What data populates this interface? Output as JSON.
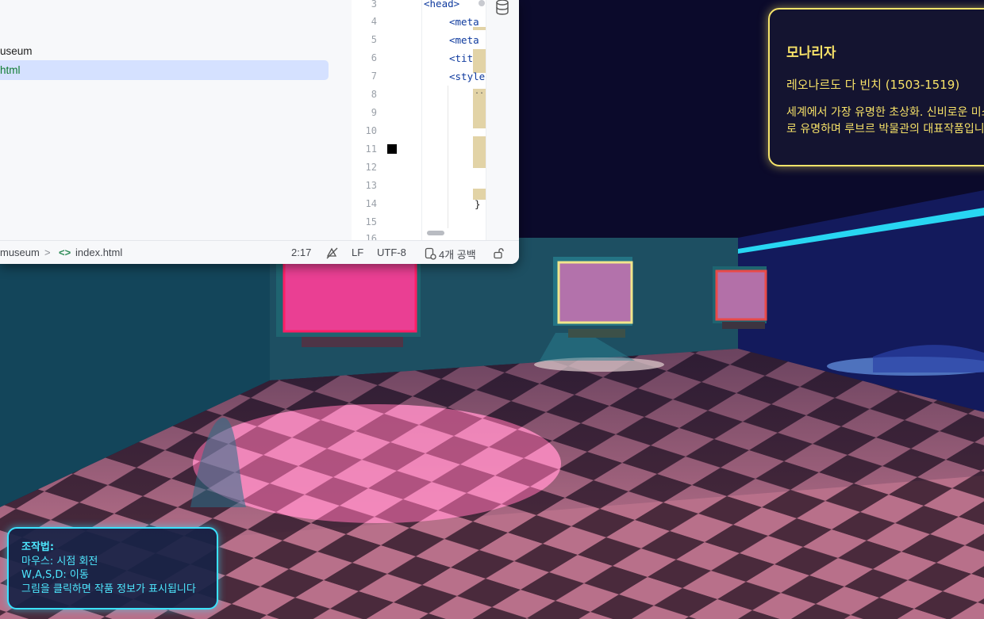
{
  "ide": {
    "tree_items": [
      "useum",
      "html"
    ],
    "line_numbers": [
      "3",
      "4",
      "5",
      "6",
      "7",
      "8",
      "9",
      "10",
      "11",
      "12",
      "13",
      "14",
      "15",
      "16"
    ],
    "code_lines": [
      "<head>",
      "<meta",
      "<meta",
      "<tit",
      "<style",
      "...",
      "}"
    ],
    "status": {
      "breadcrumb_root": "museum",
      "breadcrumb_separator": ">",
      "breadcrumb_file_icon": "<>",
      "breadcrumb_file": "index.html",
      "cursor": "2:17",
      "line_ending": "LF",
      "encoding": "UTF-8",
      "indent": "4개 공백"
    }
  },
  "info_panel": {
    "title": "모나리자",
    "artist": "레오나르도 다 빈치 (1503-1519)",
    "description": "세계에서 가장 유명한 초상화. 신비로운 미소로 유명하며 루브르 박물관의 대표작품입니다."
  },
  "controls_panel": {
    "heading": "조작법:",
    "mouse": "마우스: 시점 회전",
    "keys": "W,A,S,D: 이동",
    "click": "그림을 클릭하면 작품 정보가 표시됩니다"
  },
  "colors": {
    "info_accent": "#f6e46a",
    "controls_accent": "#3be2ff",
    "frame_pink": "#e8389a",
    "floor_light": "#b8708a",
    "floor_dark": "#4a2a3c",
    "ide_selection": "#d5e1ff"
  },
  "icons": [
    "database-icon",
    "code-brackets-icon",
    "chevron-right-icon",
    "no-inspections-icon",
    "indent-icon",
    "lock-icon"
  ]
}
